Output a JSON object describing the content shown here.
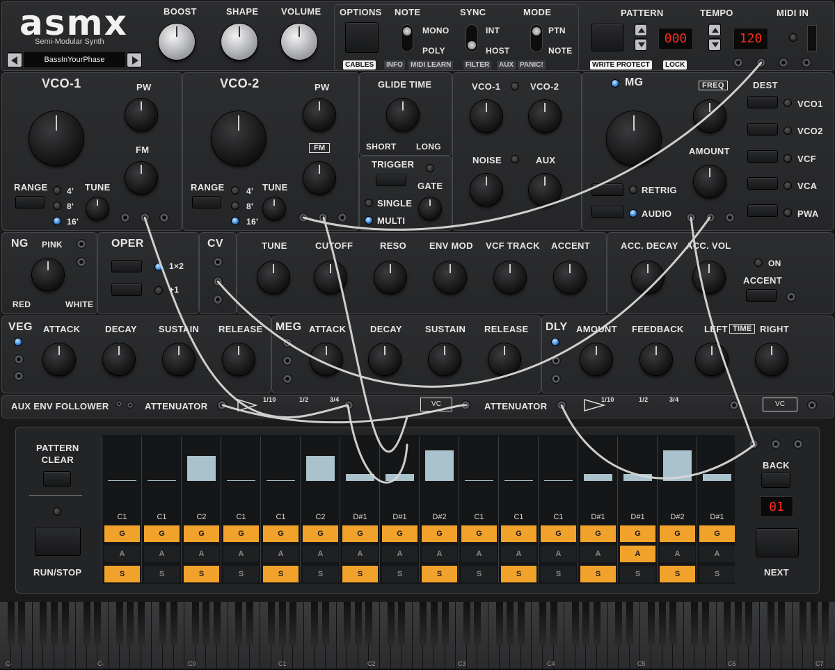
{
  "brand": {
    "logo": "asmx",
    "subtitle": "Semi-Modular Synth",
    "preset": "BassInYourPhase"
  },
  "top": {
    "knobs": [
      "BOOST",
      "SHAPE",
      "VOLUME"
    ],
    "options": {
      "label": "OPTIONS",
      "note": "NOTE",
      "mono": "MONO",
      "poly": "POLY",
      "sync": "SYNC",
      "int": "INT",
      "host": "HOST",
      "mode": "MODE",
      "ptn": "PTN",
      "note2": "NOTE"
    },
    "menu": [
      "CABLES",
      "INFO",
      "MIDI LEARN",
      "FILTER",
      "AUX",
      "PANIC!"
    ],
    "pattern": {
      "label": "PATTERN",
      "value": "000",
      "write_protect": "WRITE PROTECT",
      "lock": "LOCK"
    },
    "tempo": {
      "label": "TEMPO",
      "value": "120"
    },
    "midi_in": "MIDI IN"
  },
  "vco1": {
    "title": "VCO-1",
    "pw": "PW",
    "fm": "FM",
    "range": "RANGE",
    "tune": "TUNE",
    "r4": "4'",
    "r8": "8'",
    "r16": "16'"
  },
  "vco2": {
    "title": "VCO-2",
    "pw": "PW",
    "fm": "FM",
    "range": "RANGE",
    "tune": "TUNE",
    "r4": "4'",
    "r8": "8'",
    "r16": "16'"
  },
  "glide": {
    "title": "GLIDE TIME",
    "short": "SHORT",
    "long": "LONG",
    "trigger": "TRIGGER",
    "gate": "GATE",
    "single": "SINGLE",
    "multi": "MULTI"
  },
  "mixer": {
    "vco1": "VCO-1",
    "vco2": "VCO-2",
    "noise": "NOISE",
    "aux": "AUX"
  },
  "mg": {
    "title": "MG",
    "freq": "FREQ",
    "amount": "AMOUNT",
    "retrig": "RETRIG",
    "audio": "AUDIO",
    "dest": "DEST",
    "dests": [
      "VCO1",
      "VCO2",
      "VCF",
      "VCA",
      "PWA"
    ]
  },
  "ng": {
    "title": "NG",
    "pink": "PINK",
    "red": "RED",
    "white": "WHITE"
  },
  "oper": {
    "title": "OPER",
    "x2": "1×2",
    "x1": "+1"
  },
  "cv": {
    "title": "CV"
  },
  "filter": {
    "knobs": [
      "TUNE",
      "CUTOFF",
      "RESO",
      "ENV MOD",
      "VCF TRACK",
      "ACCENT"
    ]
  },
  "accent": {
    "acc_decay": "ACC. DECAY",
    "acc_vol": "ACC. VOL",
    "on": "ON",
    "accent": "ACCENT"
  },
  "veg": {
    "title": "VEG",
    "knobs": [
      "ATTACK",
      "DECAY",
      "SUSTAIN",
      "RELEASE"
    ]
  },
  "meg": {
    "title": "MEG",
    "knobs": [
      "ATTACK",
      "DECAY",
      "SUSTAIN",
      "RELEASE"
    ]
  },
  "dly": {
    "title": "DLY",
    "knobs": [
      "AMOUNT",
      "FEEDBACK",
      "LEFT",
      "RIGHT"
    ],
    "time": "TIME"
  },
  "utility": {
    "aux_env": "AUX ENV FOLLOWER",
    "attenuator": "ATTENUATOR",
    "a110": "1/10",
    "a12": "1/2",
    "a34": "3/4",
    "vc": "VC"
  },
  "sequencer": {
    "pattern_clear": "PATTERN\nCLEAR",
    "run_stop": "RUN/STOP",
    "back": "BACK",
    "next": "NEXT",
    "step_display": "01",
    "steps": [
      {
        "note": "C1",
        "level": 0,
        "g": true,
        "a": false,
        "s": true
      },
      {
        "note": "C1",
        "level": 0,
        "g": true,
        "a": false,
        "s": false
      },
      {
        "note": "C2",
        "level": 0.7,
        "g": true,
        "a": false,
        "s": true
      },
      {
        "note": "C1",
        "level": 0,
        "g": true,
        "a": false,
        "s": false
      },
      {
        "note": "C1",
        "level": 0,
        "g": true,
        "a": false,
        "s": true
      },
      {
        "note": "C2",
        "level": 0.7,
        "g": true,
        "a": false,
        "s": false
      },
      {
        "note": "D#1",
        "level": 0.2,
        "g": true,
        "a": false,
        "s": true
      },
      {
        "note": "D#1",
        "level": 0.2,
        "g": true,
        "a": false,
        "s": false
      },
      {
        "note": "D#2",
        "level": 0.85,
        "g": true,
        "a": false,
        "s": true
      },
      {
        "note": "C1",
        "level": 0,
        "g": true,
        "a": false,
        "s": false
      },
      {
        "note": "C1",
        "level": 0,
        "g": true,
        "a": false,
        "s": true
      },
      {
        "note": "C1",
        "level": 0,
        "g": true,
        "a": false,
        "s": false
      },
      {
        "note": "D#1",
        "level": 0.2,
        "g": true,
        "a": false,
        "s": true
      },
      {
        "note": "D#1",
        "level": 0.2,
        "g": true,
        "a": true,
        "s": false
      },
      {
        "note": "D#2",
        "level": 0.85,
        "g": true,
        "a": false,
        "s": true
      },
      {
        "note": "D#1",
        "level": 0.2,
        "g": true,
        "a": false,
        "s": false
      }
    ]
  },
  "keyboard": {
    "labels": [
      "C-",
      "C-",
      "C0",
      "C1",
      "C2",
      "C3",
      "C4",
      "C5",
      "C6",
      "C7"
    ]
  }
}
